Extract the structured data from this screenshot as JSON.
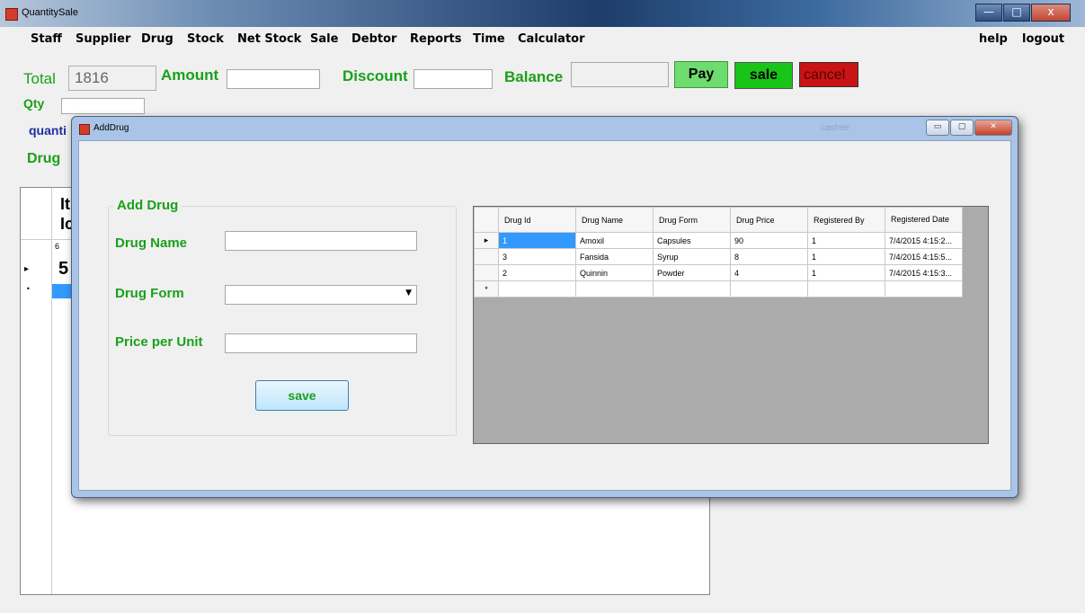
{
  "window": {
    "title": "QuantitySale",
    "min": "—",
    "max": "□",
    "close": "x"
  },
  "menu": {
    "items": [
      "Staff",
      "Supplier",
      "Drug",
      "Stock",
      "Net Stock",
      "Sale",
      "Debtor",
      "Reports",
      "Time",
      "Calculator"
    ],
    "right": [
      "help",
      "logout"
    ]
  },
  "sale": {
    "total_label": "Total",
    "total_value": "1816",
    "amount_label": "Amount",
    "amount_value": "",
    "discount_label": "Discount",
    "discount_value": "",
    "balance_label": "Balance",
    "balance_value": "",
    "qty_label": "Qty",
    "qty_value": "",
    "pay_label": "Pay",
    "sale_label": "sale",
    "cancel_label": "cancel",
    "quantity_label": "quanti",
    "drug_label": "Drug",
    "grid_header1": "It",
    "grid_header2": "Ic",
    "grid_row1_id": "6",
    "grid_row2_value": "5",
    "row_marker": "▸",
    "new_marker": "•"
  },
  "dialog": {
    "title": "AddDrug",
    "faded_text": "cashier",
    "min": "▭",
    "max": "▢",
    "close": "✕",
    "group_title": "Add Drug",
    "drug_name_label": "Drug Name",
    "drug_name_value": "",
    "drug_form_label": "Drug Form",
    "drug_form_value": "",
    "price_label": "Price per Unit",
    "price_value": "",
    "save_label": "save",
    "columns": [
      "Drug Id",
      "Drug Name",
      "Drug Form",
      "Drug Price",
      "Registered By",
      "Registered Date"
    ],
    "rows": [
      [
        "1",
        "Amoxil",
        "Capsules",
        "90",
        "1",
        "7/4/2015 4:15:2..."
      ],
      [
        "3",
        "Fansida",
        "Syrup",
        "8",
        "1",
        "7/4/2015 4:15:5..."
      ],
      [
        "2",
        "Quinnin",
        "Powder",
        "4",
        "1",
        "7/4/2015 4:15:3..."
      ]
    ],
    "current_row_marker": "▸",
    "new_row_marker": "*"
  },
  "colors": {
    "green_label": "#1aa01a",
    "pay_bg": "#6edc6e",
    "sale_bg": "#19c419",
    "cancel_bg": "#c81414",
    "selection": "#3399ff"
  }
}
